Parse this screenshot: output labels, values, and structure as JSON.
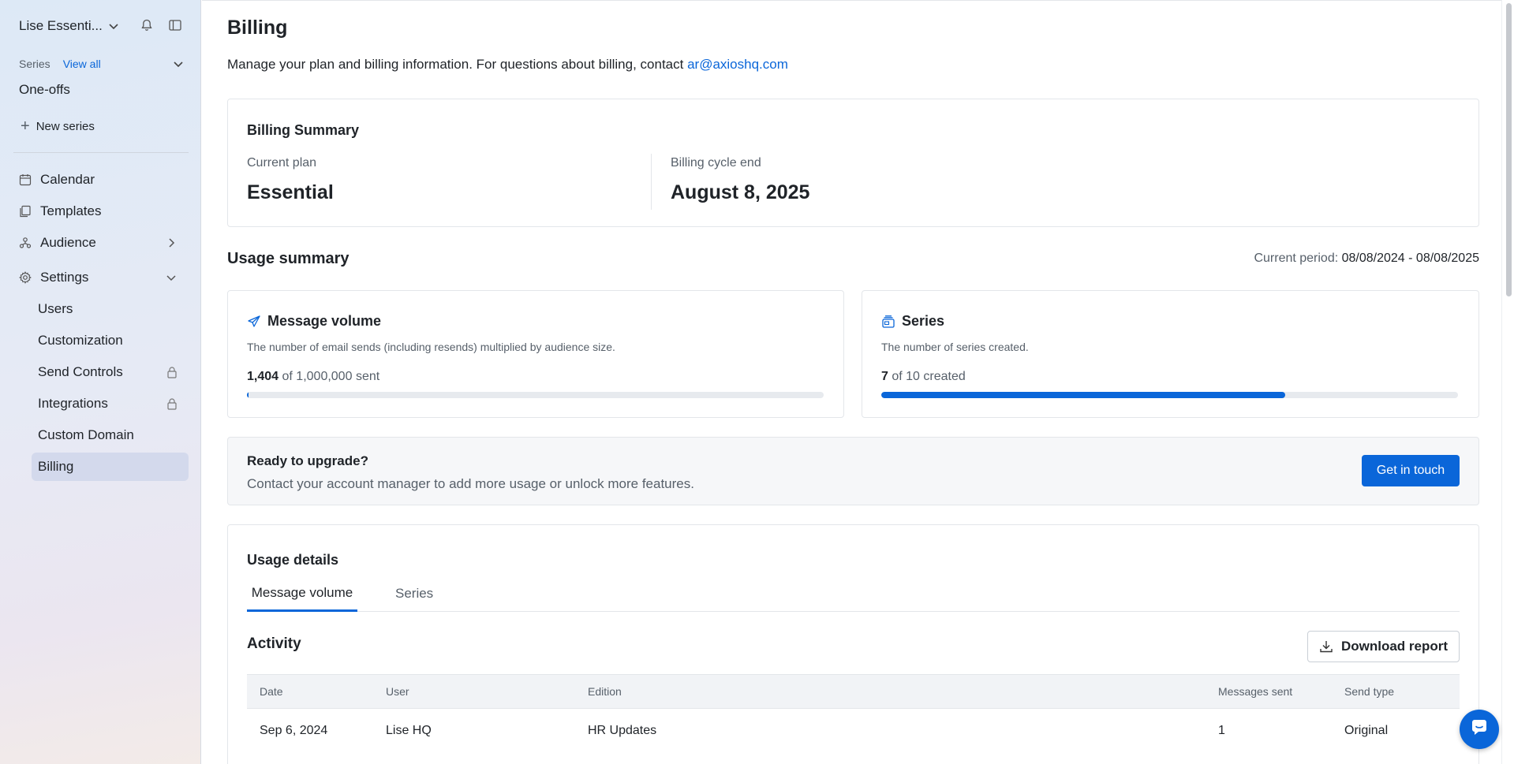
{
  "workspace": {
    "name": "Lise Essenti..."
  },
  "sidebar": {
    "series_label": "Series",
    "view_all": "View all",
    "one_offs": "One-offs",
    "new_series": "New series",
    "nav": [
      {
        "label": "Calendar",
        "icon": "calendar-icon"
      },
      {
        "label": "Templates",
        "icon": "templates-icon"
      },
      {
        "label": "Audience",
        "icon": "audience-icon"
      },
      {
        "label": "Settings",
        "icon": "gear-icon"
      }
    ],
    "settings_items": [
      {
        "label": "Users"
      },
      {
        "label": "Customization"
      },
      {
        "label": "Send Controls",
        "locked": true
      },
      {
        "label": "Integrations",
        "locked": true
      },
      {
        "label": "Custom Domain"
      },
      {
        "label": "Billing",
        "active": true
      }
    ]
  },
  "page": {
    "title": "Billing",
    "subtitle": "Manage your plan and billing information. For questions about billing, contact ",
    "contact_email": "ar@axioshq.com"
  },
  "billing_summary": {
    "title": "Billing Summary",
    "current_plan_label": "Current plan",
    "current_plan": "Essential",
    "cycle_end_label": "Billing cycle end",
    "cycle_end": "August 8, 2025"
  },
  "usage_summary": {
    "title": "Usage summary",
    "period_label": "Current period:",
    "period_value": "08/08/2024 - 08/08/2025",
    "message_volume": {
      "title": "Message volume",
      "description": "The number of email sends (including resends) multiplied by audience size.",
      "used": "1,404",
      "of": "of",
      "limit": "1,000,000",
      "suffix": "sent",
      "fraction": 0.0014
    },
    "series": {
      "title": "Series",
      "description": "The number of series created.",
      "used": "7",
      "of": "of",
      "limit": "10",
      "suffix": "created",
      "fraction": 0.7
    }
  },
  "upgrade": {
    "title": "Ready to upgrade?",
    "description": "Contact your account manager to add more usage or unlock more features.",
    "button": "Get in touch"
  },
  "usage_details": {
    "title": "Usage details",
    "tabs": [
      {
        "label": "Message volume"
      },
      {
        "label": "Series"
      }
    ],
    "activity_title": "Activity",
    "download_button": "Download report",
    "columns": {
      "date": "Date",
      "user": "User",
      "edition": "Edition",
      "messages": "Messages sent",
      "send_type": "Send type"
    },
    "rows": [
      {
        "date": "Sep 6, 2024",
        "user": "Lise HQ",
        "edition": "HR Updates",
        "messages": "1",
        "send_type": "Original"
      }
    ]
  },
  "colors": {
    "accent": "#0a66d9",
    "active_nav": "#d3d9ec"
  }
}
